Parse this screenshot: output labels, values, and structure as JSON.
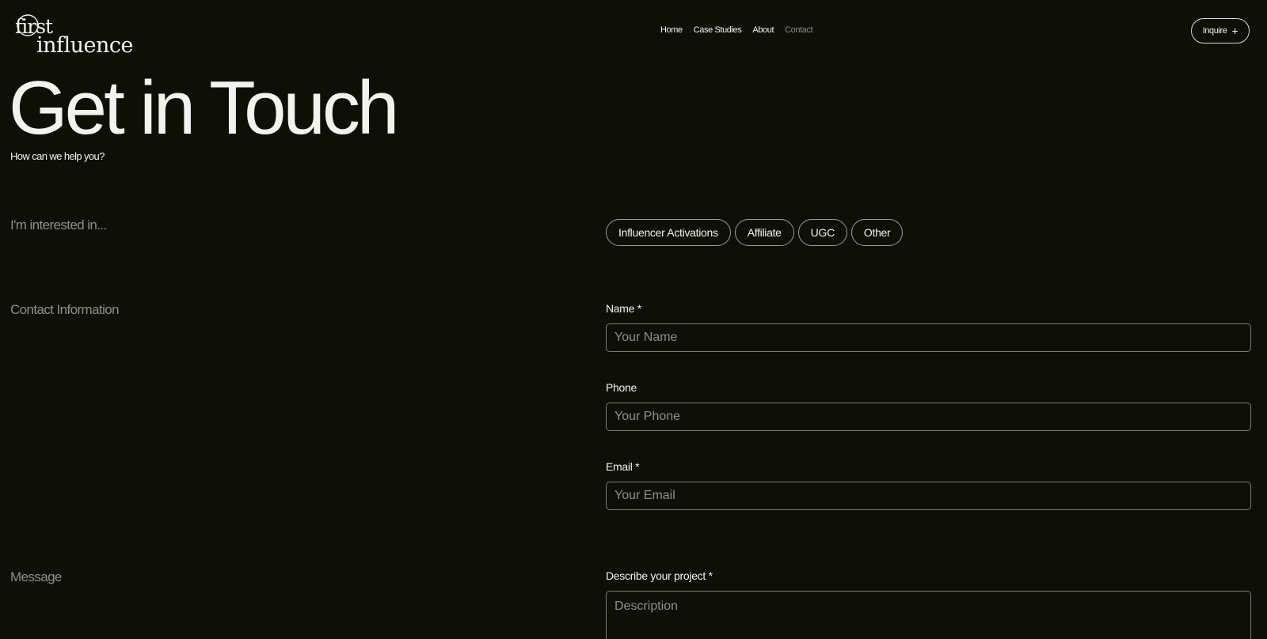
{
  "header": {
    "logo": {
      "line1": "first",
      "line2": "influence",
      "icon": "first-influence-logo"
    },
    "nav": [
      {
        "label": "Home",
        "active": false
      },
      {
        "label": "Case Studies",
        "active": false
      },
      {
        "label": "About",
        "active": false
      },
      {
        "label": "Contact",
        "active": true
      }
    ],
    "inquire": {
      "label": "Inquire",
      "icon": "plus-icon"
    }
  },
  "hero": {
    "title": "Get in Touch",
    "subtitle": "How can we help you?"
  },
  "sections": {
    "interest": "I'm interested in...",
    "contact": "Contact Information",
    "message": "Message"
  },
  "interest_options": [
    "Influencer Activations",
    "Affiliate",
    "UGC",
    "Other"
  ],
  "form": {
    "name": {
      "label": "Name *",
      "placeholder": "Your Name"
    },
    "phone": {
      "label": "Phone",
      "placeholder": "Your Phone"
    },
    "email": {
      "label": "Email *",
      "placeholder": "Your Email"
    },
    "project": {
      "label": "Describe your project *",
      "placeholder": "Description"
    }
  },
  "colors": {
    "background": "#0f1005",
    "text": "#f2f2ee",
    "muted": "#8e8e88",
    "border": "#7a7a74"
  }
}
